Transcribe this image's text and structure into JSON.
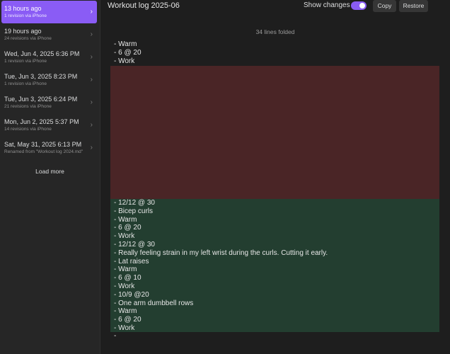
{
  "sidebar": {
    "revisions": [
      {
        "title": "13 hours ago",
        "sub": "1 revision via iPhone",
        "active": true
      },
      {
        "title": "19 hours ago",
        "sub": "24 revisions via iPhone"
      },
      {
        "title": "Wed, Jun 4, 2025 6:36 PM",
        "sub": "1 revision via iPhone"
      },
      {
        "title": "Tue, Jun 3, 2025 8:23 PM",
        "sub": "1 revision via iPhone"
      },
      {
        "title": "Tue, Jun 3, 2025 6:24 PM",
        "sub": "21 revisions via iPhone"
      },
      {
        "title": "Mon, Jun 2, 2025 5:37 PM",
        "sub": "14 revisions via iPhone"
      },
      {
        "title": "Sat, May 31, 2025 6:13 PM",
        "sub": "Renamed from \"Workout log 2024.md\""
      }
    ],
    "load_more": "Load more"
  },
  "header": {
    "title": "Workout log 2025-06",
    "show_changes_label": "Show changes",
    "show_changes_on": true,
    "copy_label": "Copy",
    "restore_label": "Restore"
  },
  "diff": {
    "folded_label": "34 lines folded",
    "context_lines": [
      "- Warm",
      "- 6 @ 20",
      "- Work"
    ],
    "added_lines": [
      "- 12/12 @ 30",
      "- Bicep curls",
      "- Warm",
      "- 6 @ 20",
      "- Work",
      "- 12/12 @ 30",
      "- Really feeling strain in my left wrist during the curls. Cutting it early.",
      "- Lat raises",
      "- Warm",
      "- 6 @ 10",
      "- Work",
      "- 10/9 @20",
      "- One arm dumbbell rows",
      "- Warm",
      "- 6 @ 20",
      "- Work"
    ],
    "trailing_lines": [
      "-"
    ]
  },
  "colors": {
    "accent": "#8a5cf5",
    "removed_bg": "#4a2526",
    "added_bg": "#233e30"
  }
}
